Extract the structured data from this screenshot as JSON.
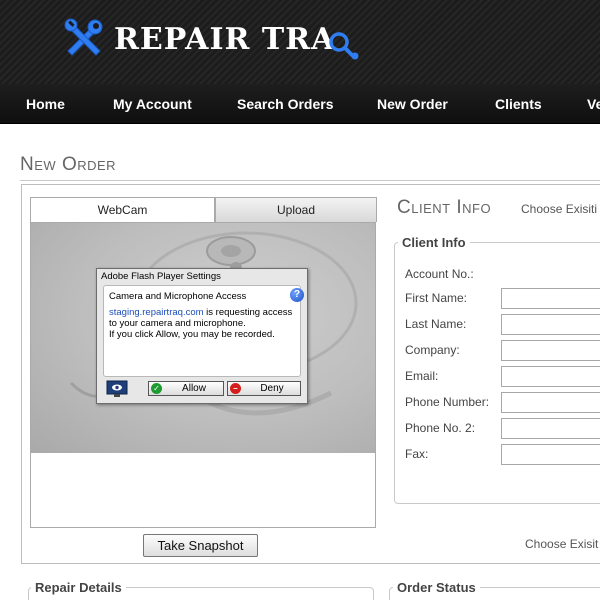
{
  "header": {
    "logo_text": "REPAIR TRA"
  },
  "nav": {
    "items": [
      "Home",
      "My Account",
      "Search Orders",
      "New Order",
      "Clients",
      "Ve"
    ]
  },
  "page": {
    "title": "New Order"
  },
  "webcam": {
    "tabs": [
      "WebCam",
      "Upload"
    ],
    "flash_dialog": {
      "title": "Adobe Flash Player Settings",
      "heading": "Camera and Microphone Access",
      "domain": "staging.repairtraq.com",
      "message_1": " is requesting access to your camera and microphone.",
      "message_2": "If you click Allow, you may be recorded.",
      "allow_label": "Allow",
      "deny_label": "Deny"
    },
    "snapshot_label": "Take Snapshot"
  },
  "client_info": {
    "title": "Client Info",
    "choose_existing_top": "Choose Exisiti",
    "legend": "Client Info",
    "fields": [
      "Account No.:",
      "First Name:",
      "Last Name:",
      "Company:",
      "Email:",
      "Phone Number:",
      "Phone No. 2:",
      "Fax:"
    ],
    "choose_existing_bottom": "Choose Exisit"
  },
  "sections": {
    "repair_details": "Repair Details",
    "order_status": "Order Status"
  },
  "colors": {
    "header_bg": "#1c1c1c",
    "logo_blue": "#2f7df0",
    "link_blue": "#1c4fb8"
  },
  "icons": [
    "wrench-screwdriver-icon",
    "wrench-tail-icon",
    "help-icon",
    "monitor-icon",
    "check-icon",
    "deny-icon"
  ]
}
